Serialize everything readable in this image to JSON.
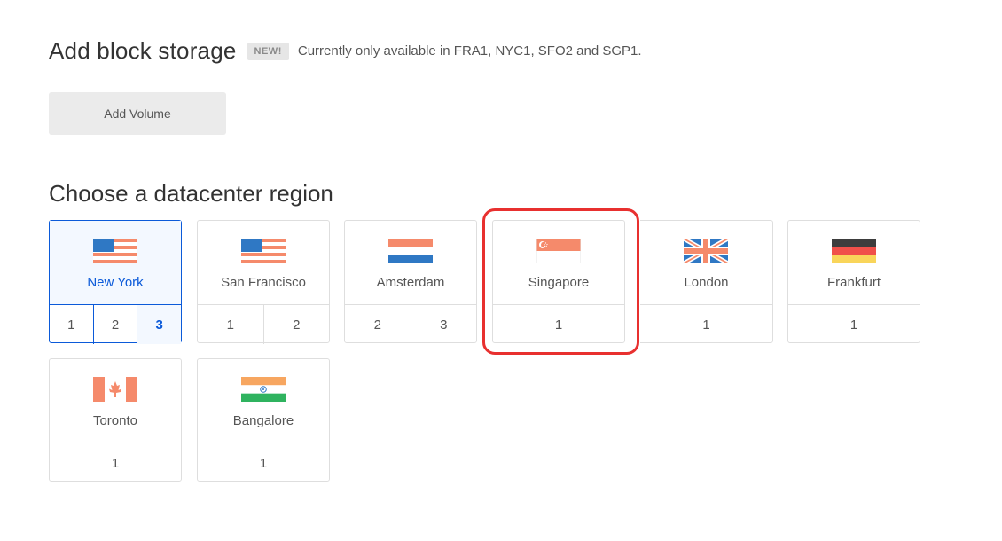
{
  "block_storage": {
    "title": "Add block storage",
    "badge": "NEW!",
    "note": "Currently only available in FRA1, NYC1, SFO2 and SGP1.",
    "button_label": "Add Volume"
  },
  "region": {
    "title": "Choose a datacenter region",
    "selected": "New York",
    "selected_number": "3",
    "regions": [
      {
        "name": "New York",
        "flag": "us-flag-icon",
        "numbers": [
          "1",
          "2",
          "3"
        ]
      },
      {
        "name": "San Francisco",
        "flag": "us-flag-icon",
        "numbers": [
          "1",
          "2"
        ]
      },
      {
        "name": "Amsterdam",
        "flag": "netherlands-flag-icon",
        "numbers": [
          "2",
          "3"
        ]
      },
      {
        "name": "Singapore",
        "flag": "singapore-flag-icon",
        "numbers": [
          "1"
        ]
      },
      {
        "name": "London",
        "flag": "uk-flag-icon",
        "numbers": [
          "1"
        ]
      },
      {
        "name": "Frankfurt",
        "flag": "germany-flag-icon",
        "numbers": [
          "1"
        ]
      },
      {
        "name": "Toronto",
        "flag": "canada-flag-icon",
        "numbers": [
          "1"
        ]
      },
      {
        "name": "Bangalore",
        "flag": "india-flag-icon",
        "numbers": [
          "1"
        ]
      }
    ]
  },
  "colors": {
    "accent": "#0b5ad9",
    "highlight": "#e8302f",
    "flag_red": "#f58a6b",
    "flag_blue": "#2f78c4"
  }
}
